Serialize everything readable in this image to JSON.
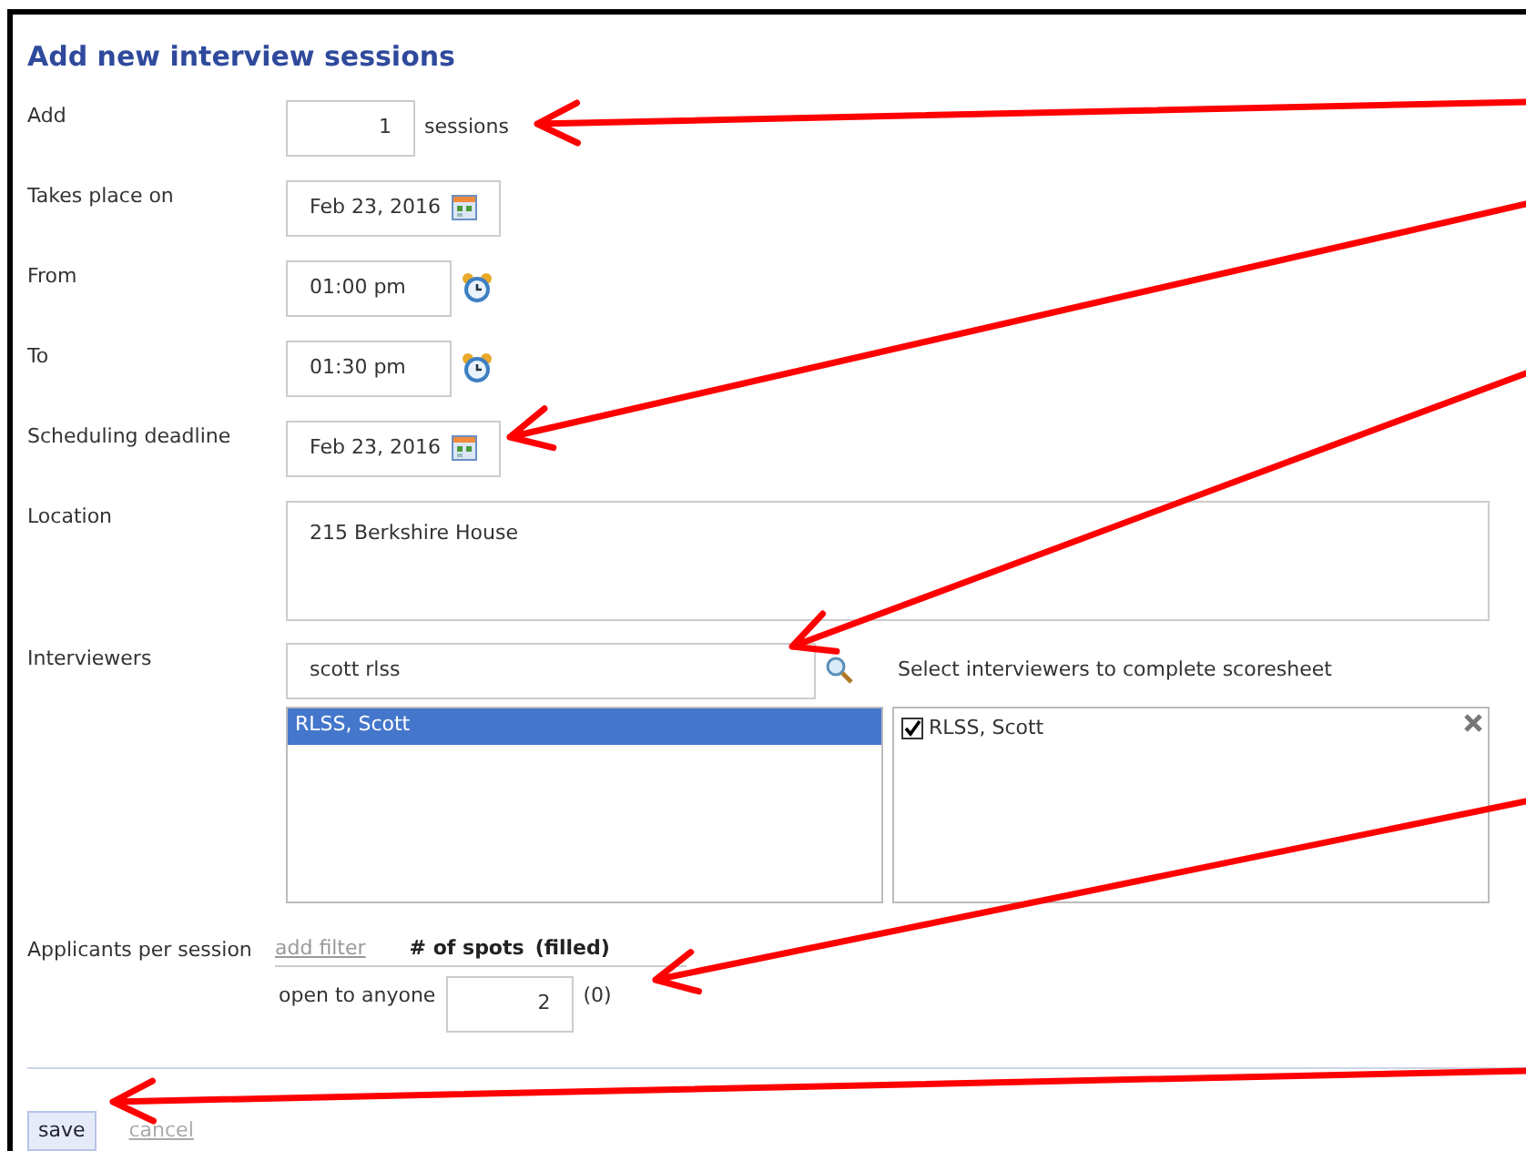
{
  "title": "Add new interview sessions",
  "rows": [
    {
      "label": "Add",
      "kind": "number",
      "value": "1",
      "suffix": "sessions"
    },
    {
      "label": "Takes place on",
      "kind": "date",
      "value": "Feb 23, 2016"
    },
    {
      "label": "From",
      "kind": "time",
      "value": "01:00 pm"
    },
    {
      "label": "To",
      "kind": "time",
      "value": "01:30 pm"
    },
    {
      "label": "Scheduling deadline",
      "kind": "date",
      "value": "Feb 23, 2016"
    },
    {
      "label": "Location",
      "kind": "textarea",
      "value": "215 Berkshire House"
    }
  ],
  "interviewers": {
    "label": "Interviewers",
    "search_value": "scott rlss",
    "hint": "Select interviewers to complete scoresheet",
    "results": [
      {
        "name": "RLSS, Scott",
        "selected": true
      }
    ],
    "chosen": [
      {
        "name": "RLSS, Scott",
        "checked": true
      }
    ]
  },
  "applicants": {
    "label": "Applicants per session",
    "filter_link": "add filter",
    "spots_header": "# of spots",
    "filled_header": "(filled)",
    "groups": [
      {
        "label": "open to anyone",
        "spots": "2",
        "filled": "(0)"
      }
    ]
  },
  "actions": [
    {
      "kind": "button",
      "label": "save"
    },
    {
      "kind": "link",
      "label": "cancel"
    }
  ]
}
